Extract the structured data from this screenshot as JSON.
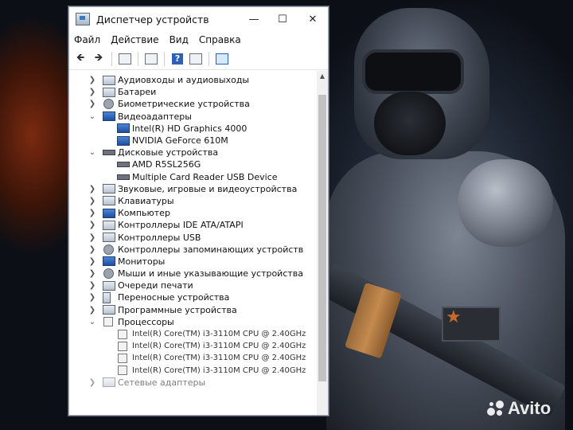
{
  "window": {
    "title": "Диспетчер устройств",
    "controls": {
      "minimize": "—",
      "maximize": "☐",
      "close": "✕"
    }
  },
  "menu": [
    "Файл",
    "Действие",
    "Вид",
    "Справка"
  ],
  "toolbar": [
    "back-icon",
    "forward-icon",
    "properties-icon",
    "update-icon",
    "help-icon",
    "view-icon",
    "scan-icon"
  ],
  "tree": [
    {
      "label": "Аудиовходы и аудиовыходы",
      "expanded": false,
      "icon": "audio-icon"
    },
    {
      "label": "Батареи",
      "expanded": false,
      "icon": "battery-icon"
    },
    {
      "label": "Биометрические устройства",
      "expanded": false,
      "icon": "biometric-icon"
    },
    {
      "label": "Видеоадаптеры",
      "expanded": true,
      "icon": "display-adapter-icon"
    },
    {
      "label": "Intel(R) HD Graphics 4000",
      "child": true,
      "icon": "display-adapter-icon"
    },
    {
      "label": "NVIDIA GeForce 610M",
      "child": true,
      "icon": "display-adapter-icon"
    },
    {
      "label": "Дисковые устройства",
      "expanded": true,
      "icon": "disk-icon"
    },
    {
      "label": "AMD R5SL256G",
      "child": true,
      "icon": "disk-icon"
    },
    {
      "label": "Multiple Card  Reader USB Device",
      "child": true,
      "icon": "disk-icon"
    },
    {
      "label": "Звуковые, игровые и видеоустройства",
      "expanded": false,
      "icon": "sound-icon"
    },
    {
      "label": "Клавиатуры",
      "expanded": false,
      "icon": "keyboard-icon"
    },
    {
      "label": "Компьютер",
      "expanded": false,
      "icon": "computer-icon"
    },
    {
      "label": "Контроллеры IDE ATA/ATAPI",
      "expanded": false,
      "icon": "ide-icon"
    },
    {
      "label": "Контроллеры USB",
      "expanded": false,
      "icon": "usb-icon"
    },
    {
      "label": "Контроллеры запоминающих устройств",
      "expanded": false,
      "icon": "storage-icon"
    },
    {
      "label": "Мониторы",
      "expanded": false,
      "icon": "monitor-icon"
    },
    {
      "label": "Мыши и иные указывающие устройства",
      "expanded": false,
      "icon": "mouse-icon"
    },
    {
      "label": "Очереди печати",
      "expanded": false,
      "icon": "printer-icon"
    },
    {
      "label": "Переносные устройства",
      "expanded": false,
      "icon": "portable-icon"
    },
    {
      "label": "Программные устройства",
      "expanded": false,
      "icon": "software-icon"
    },
    {
      "label": "Процессоры",
      "expanded": true,
      "icon": "cpu-icon"
    },
    {
      "label": "Intel(R) Core(TM) i3-3110M CPU @ 2.40GHz",
      "child": true,
      "icon": "cpu-icon"
    },
    {
      "label": "Intel(R) Core(TM) i3-3110M CPU @ 2.40GHz",
      "child": true,
      "icon": "cpu-icon"
    },
    {
      "label": "Intel(R) Core(TM) i3-3110M CPU @ 2.40GHz",
      "child": true,
      "icon": "cpu-icon"
    },
    {
      "label": "Intel(R) Core(TM) i3-3110M CPU @ 2.40GHz",
      "child": true,
      "icon": "cpu-icon"
    },
    {
      "label": "Сетевые адаптеры",
      "expanded": false,
      "icon": "network-icon"
    }
  ],
  "watermark": "Avito"
}
